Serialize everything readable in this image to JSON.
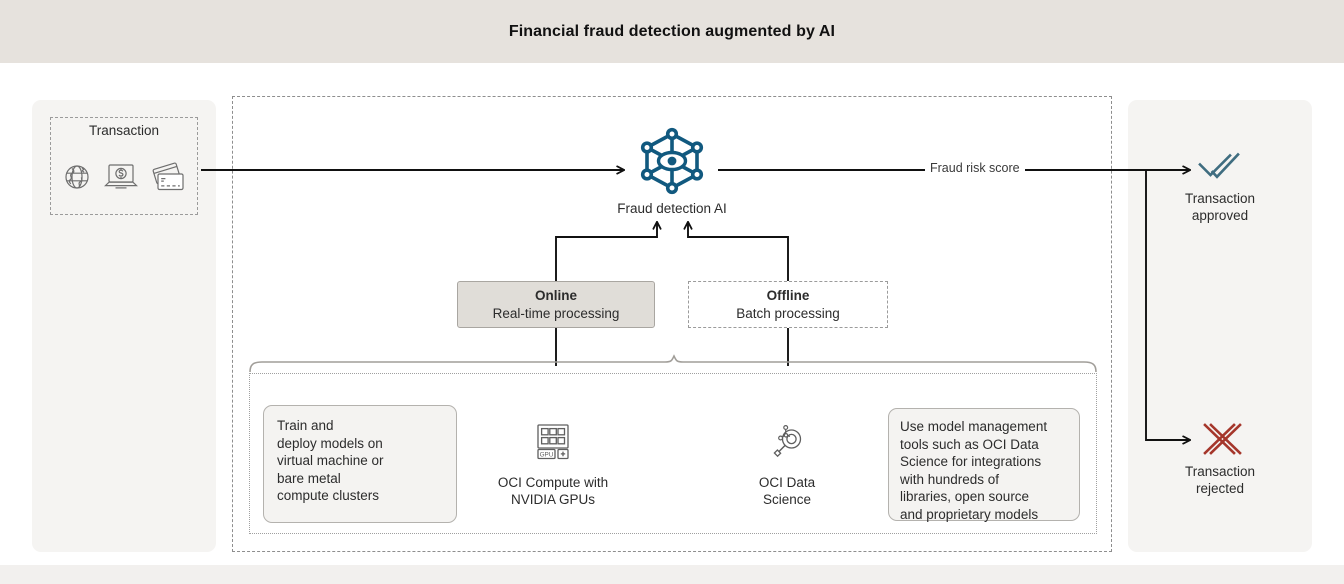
{
  "header": {
    "title": "Financial fraud detection augmented by AI"
  },
  "colors": {
    "header_band": "#e6e2dd",
    "panel": "#f5f4f2",
    "ai_node": "#11597f",
    "approved": "#3f6d80",
    "rejected": "#a5362b",
    "icon_gray": "#6e6e6e",
    "connector": "#111111"
  },
  "left_panel": {
    "transaction": {
      "label": "Transaction",
      "icons": [
        {
          "name": "globe-icon",
          "alt": "globe"
        },
        {
          "name": "laptop-payment-icon",
          "alt": "laptop with dollar sign"
        },
        {
          "name": "credit-cards-icon",
          "alt": "credit cards"
        }
      ]
    }
  },
  "main": {
    "ai_node": {
      "icon": "network-eye-icon",
      "label": "Fraud detection AI"
    },
    "processing": [
      {
        "name": "online",
        "title": "Online",
        "subtitle": "Real-time processing",
        "style": "filled"
      },
      {
        "name": "offline",
        "title": "Offline",
        "subtitle": "Batch processing",
        "style": "dashed"
      }
    ],
    "infrastructure": [
      {
        "kind": "callout",
        "name": "train-deploy-callout",
        "text": "Train and\ndeploy models on\nvirtual machine or\nbare metal\ncompute clusters"
      },
      {
        "kind": "service",
        "name": "oci-compute",
        "icon": "gpu-chip-icon",
        "icon_label": "GPU",
        "text": "OCI Compute with\nNVIDIA GPUs"
      },
      {
        "kind": "service",
        "name": "oci-data-science",
        "icon": "data-science-magnifier-icon",
        "text": "OCI Data\nScience"
      },
      {
        "kind": "callout",
        "name": "model-management-callout",
        "text": "Use model management\ntools such as OCI Data\nScience for integrations\nwith hundreds of\nlibraries, open source\nand proprietary models"
      }
    ]
  },
  "connectors": {
    "fraud_risk_score_label": "Fraud risk score"
  },
  "right_panel": {
    "outcomes": [
      {
        "name": "transaction-approved",
        "icon": "double-check-icon",
        "text": "Transaction\napproved"
      },
      {
        "name": "transaction-rejected",
        "icon": "cross-x-icon",
        "text": "Transaction\nrejected"
      }
    ]
  }
}
